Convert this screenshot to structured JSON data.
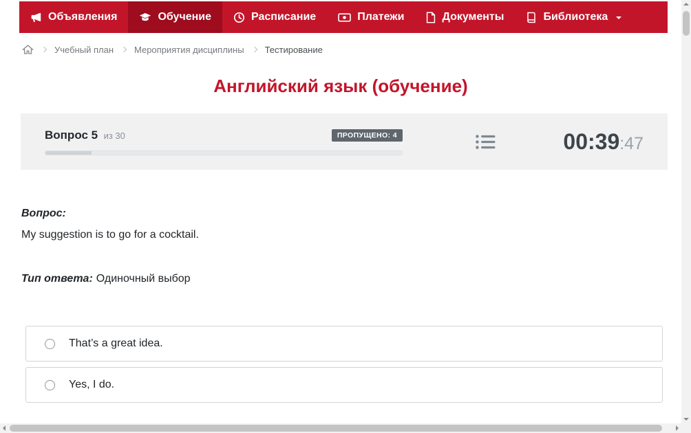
{
  "nav": {
    "items": [
      {
        "label": "Объявления",
        "icon": "megaphone-icon",
        "active": false
      },
      {
        "label": "Обучение",
        "icon": "graduation-cap-icon",
        "active": true
      },
      {
        "label": "Расписание",
        "icon": "clock-icon",
        "active": false
      },
      {
        "label": "Платежи",
        "icon": "banknote-icon",
        "active": false
      },
      {
        "label": "Документы",
        "icon": "document-icon",
        "active": false
      },
      {
        "label": "Библиотека",
        "icon": "book-icon",
        "active": false,
        "has_dropdown": true
      }
    ]
  },
  "breadcrumb": {
    "items": [
      {
        "label": "Учебный план"
      },
      {
        "label": "Мероприятия дисциплины"
      },
      {
        "label": "Тестирование"
      }
    ]
  },
  "page": {
    "title": "Английский язык (обучение)"
  },
  "quiz_header": {
    "question_label": "Вопрос 5",
    "question_of": "из 30",
    "skipped_badge": "ПРОПУЩЕНО: 4",
    "timer_main": "00:39",
    "timer_seconds": ":47",
    "progress_percent": 13
  },
  "question": {
    "label": "Вопрос:",
    "text": "My suggestion is to go for a cocktail.",
    "type_label": "Тип ответа:",
    "type_value": "Одиночный выбор"
  },
  "answers": [
    {
      "text": "That’s a great idea."
    },
    {
      "text": "Yes, I do."
    }
  ],
  "colors": {
    "accent": "#c3152a",
    "nav_active": "#9e0c1e",
    "badge_bg": "#5f666d"
  }
}
